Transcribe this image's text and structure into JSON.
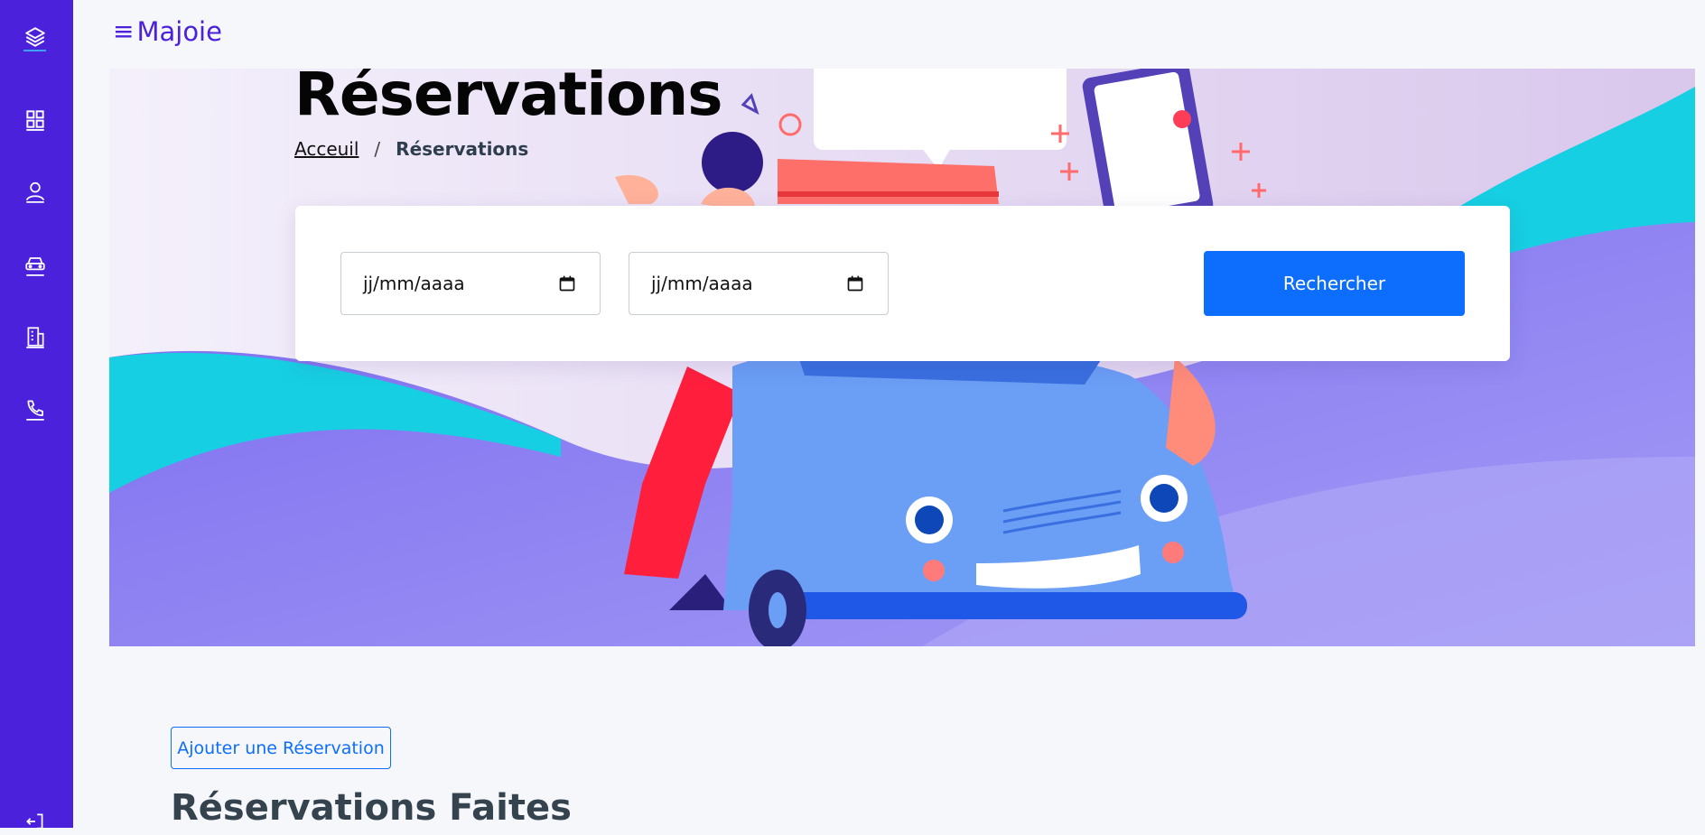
{
  "app": {
    "brand": "Majoie"
  },
  "sidebar": {
    "items": [
      {
        "icon": "layers-icon"
      },
      {
        "icon": "grid-icon"
      },
      {
        "icon": "user-icon"
      },
      {
        "icon": "car-icon"
      },
      {
        "icon": "building-icon"
      },
      {
        "icon": "phone-icon"
      },
      {
        "icon": "logout-icon"
      }
    ],
    "color": "#4b21db"
  },
  "hero": {
    "title": "Réservations",
    "breadcrumb": {
      "home": "Acceuil",
      "separator": "/",
      "current": "Réservations"
    }
  },
  "search": {
    "date_from_placeholder": "jj/mm/aaaa",
    "date_to_placeholder": "jj/mm/aaaa",
    "button_label": "Rechercher"
  },
  "main": {
    "add_button_label": "Ajouter une Réservation",
    "section_title": "Réservations Faites"
  },
  "colors": {
    "primary": "#0d6efd",
    "sidebar": "#4b21db",
    "background": "#f6f7fb"
  }
}
